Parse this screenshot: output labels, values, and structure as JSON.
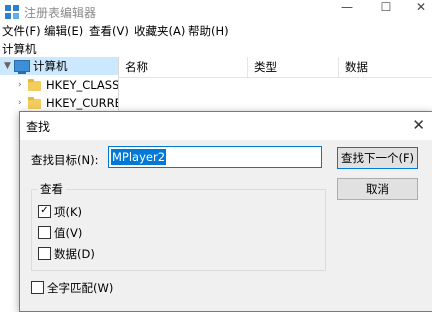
{
  "window": {
    "title": "注册表编辑器",
    "min_glyph": "—",
    "max_glyph": "☐",
    "close_glyph": "✕"
  },
  "menubar": {
    "items": [
      "文件(F)",
      "编辑(E)",
      "查看(V)",
      "收藏夹(A)",
      "帮助(H)"
    ]
  },
  "address": {
    "path": "计算机"
  },
  "tree": {
    "root": "计算机",
    "items": [
      "HKEY_CLASSES",
      "HKEY_CURREN"
    ]
  },
  "list": {
    "columns": [
      "名称",
      "类型",
      "数据"
    ]
  },
  "find_dialog": {
    "title": "查找",
    "close_glyph": "✕",
    "find_label": "查找目标(N):",
    "find_value": "MPlayer2",
    "find_next_label": "查找下一个(F)",
    "cancel_label": "取消",
    "look_at_label": "查看",
    "options": [
      {
        "label": "项(K)",
        "checked": true
      },
      {
        "label": "值(V)",
        "checked": false
      },
      {
        "label": "数据(D)",
        "checked": false
      }
    ],
    "match_whole": {
      "label": "全字匹配(W)",
      "checked": false
    },
    "accent_color": "#0078d7"
  }
}
